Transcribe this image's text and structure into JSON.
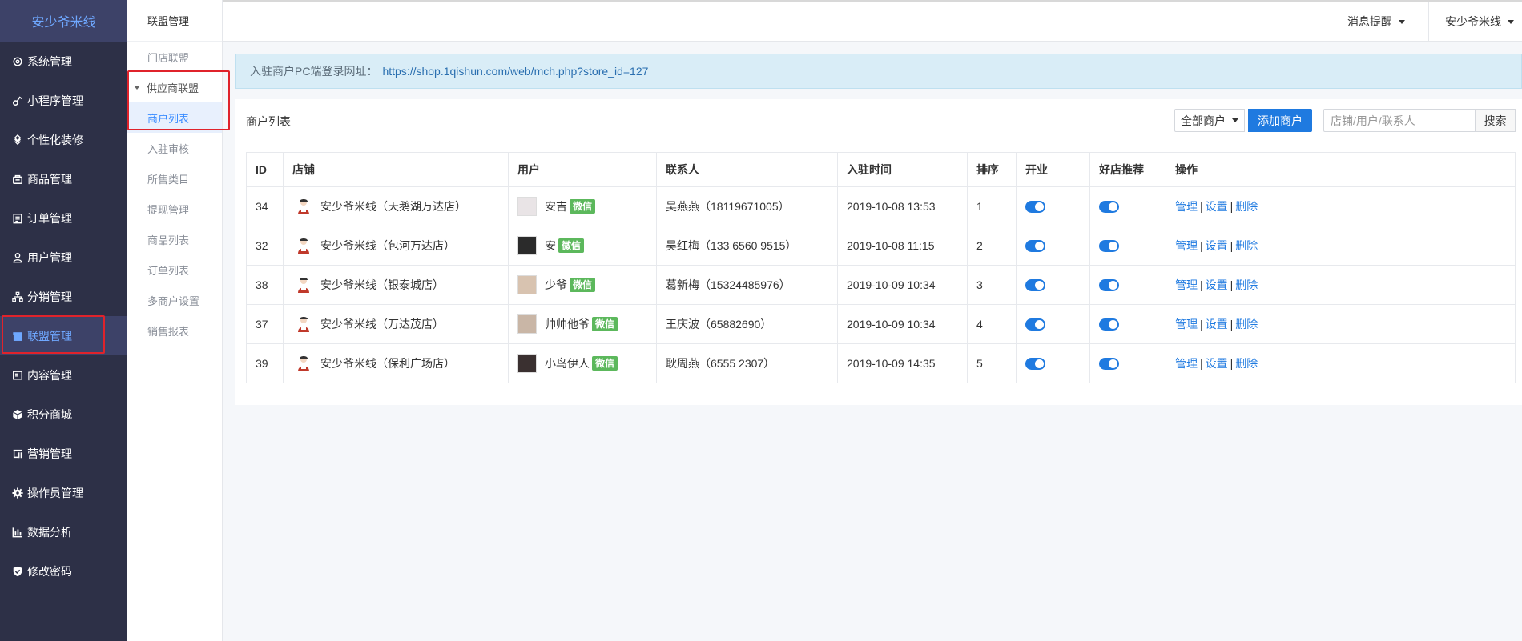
{
  "sidebar": {
    "brand": "安少爷米线",
    "items": [
      {
        "label": "系统管理",
        "icon": "gear-outline-icon"
      },
      {
        "label": "小程序管理",
        "icon": "link-icon"
      },
      {
        "label": "个性化装修",
        "icon": "diamond-cluster-icon"
      },
      {
        "label": "商品管理",
        "icon": "bag-icon"
      },
      {
        "label": "订单管理",
        "icon": "clipboard-icon"
      },
      {
        "label": "用户管理",
        "icon": "user-icon"
      },
      {
        "label": "分销管理",
        "icon": "network-icon"
      },
      {
        "label": "联盟管理",
        "icon": "store-icon",
        "active": true
      },
      {
        "label": "内容管理",
        "icon": "content-icon"
      },
      {
        "label": "积分商城",
        "icon": "cube-icon"
      },
      {
        "label": "营销管理",
        "icon": "marketing-icon"
      },
      {
        "label": "操作员管理",
        "icon": "gear-solid-icon"
      },
      {
        "label": "数据分析",
        "icon": "bar-chart-icon"
      },
      {
        "label": "修改密码",
        "icon": "shield-check-icon"
      }
    ],
    "accent": "#6fa8ff"
  },
  "subnav": {
    "title": "联盟管理",
    "items": [
      "门店联盟",
      "供应商联盟",
      "商户列表",
      "入驻审核",
      "所售类目",
      "提现管理",
      "商品列表",
      "订单列表",
      "多商户设置",
      "销售报表"
    ]
  },
  "header": {
    "messages": "消息提醒",
    "user": "安少爷米线"
  },
  "notice": {
    "label": "入驻商户PC端登录网址：",
    "url": "https://shop.1qishun.com/web/mch.php?store_id=127"
  },
  "panel": {
    "title": "商户列表",
    "filter": "全部商户",
    "add": "添加商户",
    "search_placeholder": "店铺/用户/联系人",
    "search": "搜索"
  },
  "table": {
    "columns": [
      "ID",
      "店铺",
      "用户",
      "联系人",
      "入驻时间",
      "排序",
      "开业",
      "好店推荐",
      "操作"
    ],
    "wechat_tag": "微信",
    "ops": [
      "管理",
      "设置",
      "删除"
    ],
    "rows": [
      {
        "id": "34",
        "shop": "安少爷米线（天鹅湖万达店）",
        "user": "安吉",
        "contact": "吴燕燕（18119671005）",
        "time": "2019-10-08 13:53",
        "sort": "1",
        "open": true,
        "recommend": true
      },
      {
        "id": "32",
        "shop": "安少爷米线（包河万达店）",
        "user": "安",
        "contact": "吴红梅（133 6560 9515）",
        "time": "2019-10-08 11:15",
        "sort": "2",
        "open": true,
        "recommend": true
      },
      {
        "id": "38",
        "shop": "安少爷米线（银泰城店）",
        "user": "少爷",
        "contact": "葛新梅（15324485976）",
        "time": "2019-10-09 10:34",
        "sort": "3",
        "open": true,
        "recommend": true
      },
      {
        "id": "37",
        "shop": "安少爷米线（万达茂店）",
        "user": "帅帅他爷",
        "contact": "王庆波（65882690）",
        "time": "2019-10-09 10:34",
        "sort": "4",
        "open": true,
        "recommend": true
      },
      {
        "id": "39",
        "shop": "安少爷米线（保利广场店）",
        "user": "小鸟伊人",
        "contact": "耿周燕（6555 2307）",
        "time": "2019-10-09 14:35",
        "sort": "5",
        "open": true,
        "recommend": true
      }
    ]
  }
}
